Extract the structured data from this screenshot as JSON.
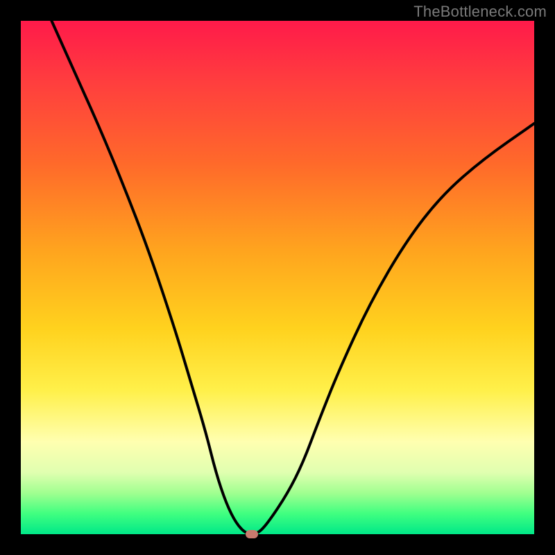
{
  "watermark": "TheBottleneck.com",
  "chart_data": {
    "type": "line",
    "title": "",
    "xlabel": "",
    "ylabel": "",
    "xlim": [
      0,
      100
    ],
    "ylim": [
      0,
      100
    ],
    "series": [
      {
        "name": "bottleneck-curve",
        "x": [
          6,
          10,
          15,
          20,
          25,
          30,
          33,
          36,
          38,
          40,
          42,
          44,
          46,
          48,
          52,
          55,
          58,
          62,
          68,
          75,
          82,
          90,
          100
        ],
        "y": [
          100,
          91,
          80,
          68,
          55,
          40,
          30,
          20,
          12,
          6,
          2,
          0,
          0,
          2,
          8,
          14,
          22,
          32,
          45,
          57,
          66,
          73,
          80
        ]
      }
    ],
    "marker": {
      "x": 45,
      "y": 0,
      "color": "#c97a6e"
    },
    "background_gradient": {
      "top": "#ff1a4a",
      "mid": "#ffd21e",
      "bottom": "#00e888"
    }
  }
}
